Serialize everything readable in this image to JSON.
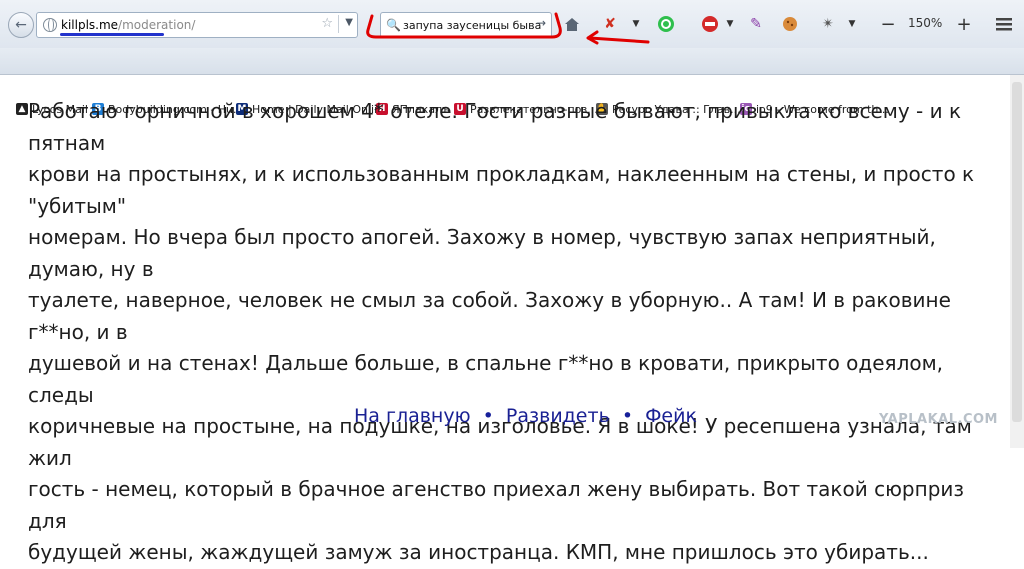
{
  "browser": {
    "url_host": "killpls.me",
    "url_path": "/moderation/",
    "search_text": "запупа заусеницы быва",
    "zoom": "150%",
    "bookmarks": [
      {
        "label": "Lycos Mail",
        "icon": "lycos-dog-icon",
        "color": "#222"
      },
      {
        "label": "Bodybuilding.com - Hu...",
        "icon": "bodybuilding-icon",
        "color": "#1f7fd6"
      },
      {
        "label": "Home | Daily Mail Online",
        "icon": "dailymail-icon",
        "color": "#0d2d7a"
      },
      {
        "label": "ЯПлакалъ",
        "icon": "yaplakal-icon",
        "color": "#c8102e"
      },
      {
        "label": "Развлекательно-поз...",
        "icon": "u-icon",
        "color": "#c8102e"
      },
      {
        "label": "Ресурс Удава :: Глав...",
        "icon": "hand-icon",
        "color": "#333"
      },
      {
        "label": "io9 - We come from th...",
        "icon": "io9-icon",
        "color": "#9b59b6"
      }
    ]
  },
  "post": {
    "lines": [
      "Работаю горничной в хорошем 4* отеле. Гости разные бывают, привыкла ко всему - и к пятнам",
      "крови на простынях, и к использованным прокладкам, наклеенным на стены, и просто к \"убитым\"",
      "номерам. Но вчера был просто апогей. Захожу в номер, чувствую запах неприятный, думаю, ну в",
      "туалете, наверное, человек не смыл за собой. Захожу в уборную.. А там! И в раковине г**но, и в",
      "душевой и на стенах! Дальше больше, в спальне г**но в кровати, прикрыто одеялом, следы",
      "коричневые на простыне, на подушке, на изголовье. Я в шоке! У ресепшена узнала, там жил",
      "гость - немец, который в брачное агенство приехал жену выбирать. Вот такой сюрприз для",
      "будущей жены, жаждущей замуж за иностранца. КМП, мне пришлось это убирать..."
    ]
  },
  "nav": {
    "home": "На главную",
    "sep": "•",
    "fake_out": "Развидеть",
    "fake": "Фейк"
  },
  "watermark": "YAPLAKAL.COM",
  "colors": {
    "link": "#1a2193",
    "annotation": "#e00000",
    "url_underline": "#2233cc"
  }
}
